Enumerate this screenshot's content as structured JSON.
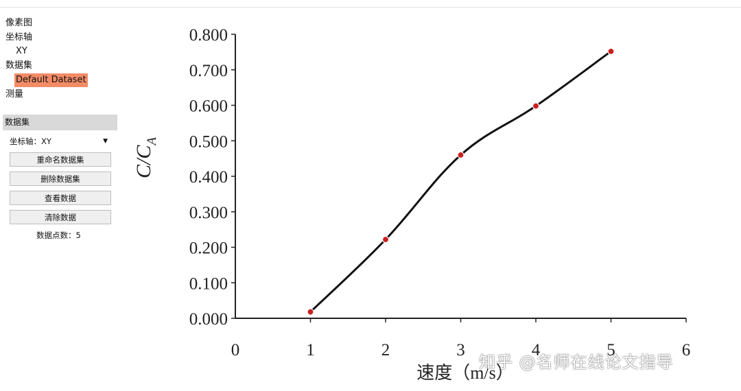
{
  "tree": {
    "pixel_map": "像素图",
    "axes": "坐标轴",
    "axes_child": "XY",
    "datasets": "数据集",
    "dataset_item": "Default Dataset",
    "measure": "测量"
  },
  "panel": {
    "header": "数据集",
    "axis_label": "坐标轴：",
    "axis_value": "XY",
    "rename_button": "重命名数据集",
    "delete_button": "删除数据集",
    "view_button": "查看数据",
    "clear_button": "清除数据",
    "count_label": "数据点数：",
    "count_value": "5"
  },
  "colors": {
    "selected_bg": "#f28b66",
    "point_fill": "#cc1f1f",
    "line": "#111111"
  },
  "chart_data": {
    "type": "line",
    "xlabel": "速度（m/s）",
    "ylabel_main": "C/C",
    "ylabel_sub": "A",
    "x_ticks": [
      "0",
      "1",
      "2",
      "3",
      "4",
      "5",
      "6"
    ],
    "y_ticks": [
      "0.000",
      "0.100",
      "0.200",
      "0.300",
      "0.400",
      "0.500",
      "0.600",
      "0.700",
      "0.800"
    ],
    "xlim": [
      0,
      6
    ],
    "ylim": [
      0,
      0.8
    ],
    "x": [
      1,
      2,
      3,
      4,
      5
    ],
    "y": [
      0.018,
      0.222,
      0.46,
      0.598,
      0.752
    ],
    "grid": false
  },
  "watermark": "知乎 @名师在线论文指导"
}
